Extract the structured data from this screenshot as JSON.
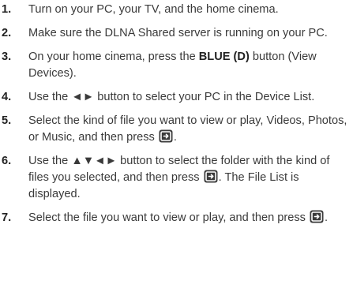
{
  "icons": {
    "enter": "enter-button-icon"
  },
  "steps": [
    {
      "num": "1.",
      "text": "Turn on your PC, your TV, and the home cinema."
    },
    {
      "num": "2.",
      "text": "Make sure the DLNA Shared server is running on your PC."
    },
    {
      "num": "3.",
      "pre": "On your home cinema, press the ",
      "bold": "BLUE (D)",
      "post": " button (View Devices)."
    },
    {
      "num": "4.",
      "text": "Use the ◄► button to select your PC in the Device List."
    },
    {
      "num": "5.",
      "pre": "Select the kind of file you want to view or play, Videos, Photos, or Music, and then press ",
      "post": "."
    },
    {
      "num": "6.",
      "pre": "Use the ▲▼◄► button to select the folder with the kind of files you selected, and then press ",
      "post": ". The File List is displayed."
    },
    {
      "num": "7.",
      "pre": "Select the file you want to view or play, and then press ",
      "post": "."
    }
  ]
}
